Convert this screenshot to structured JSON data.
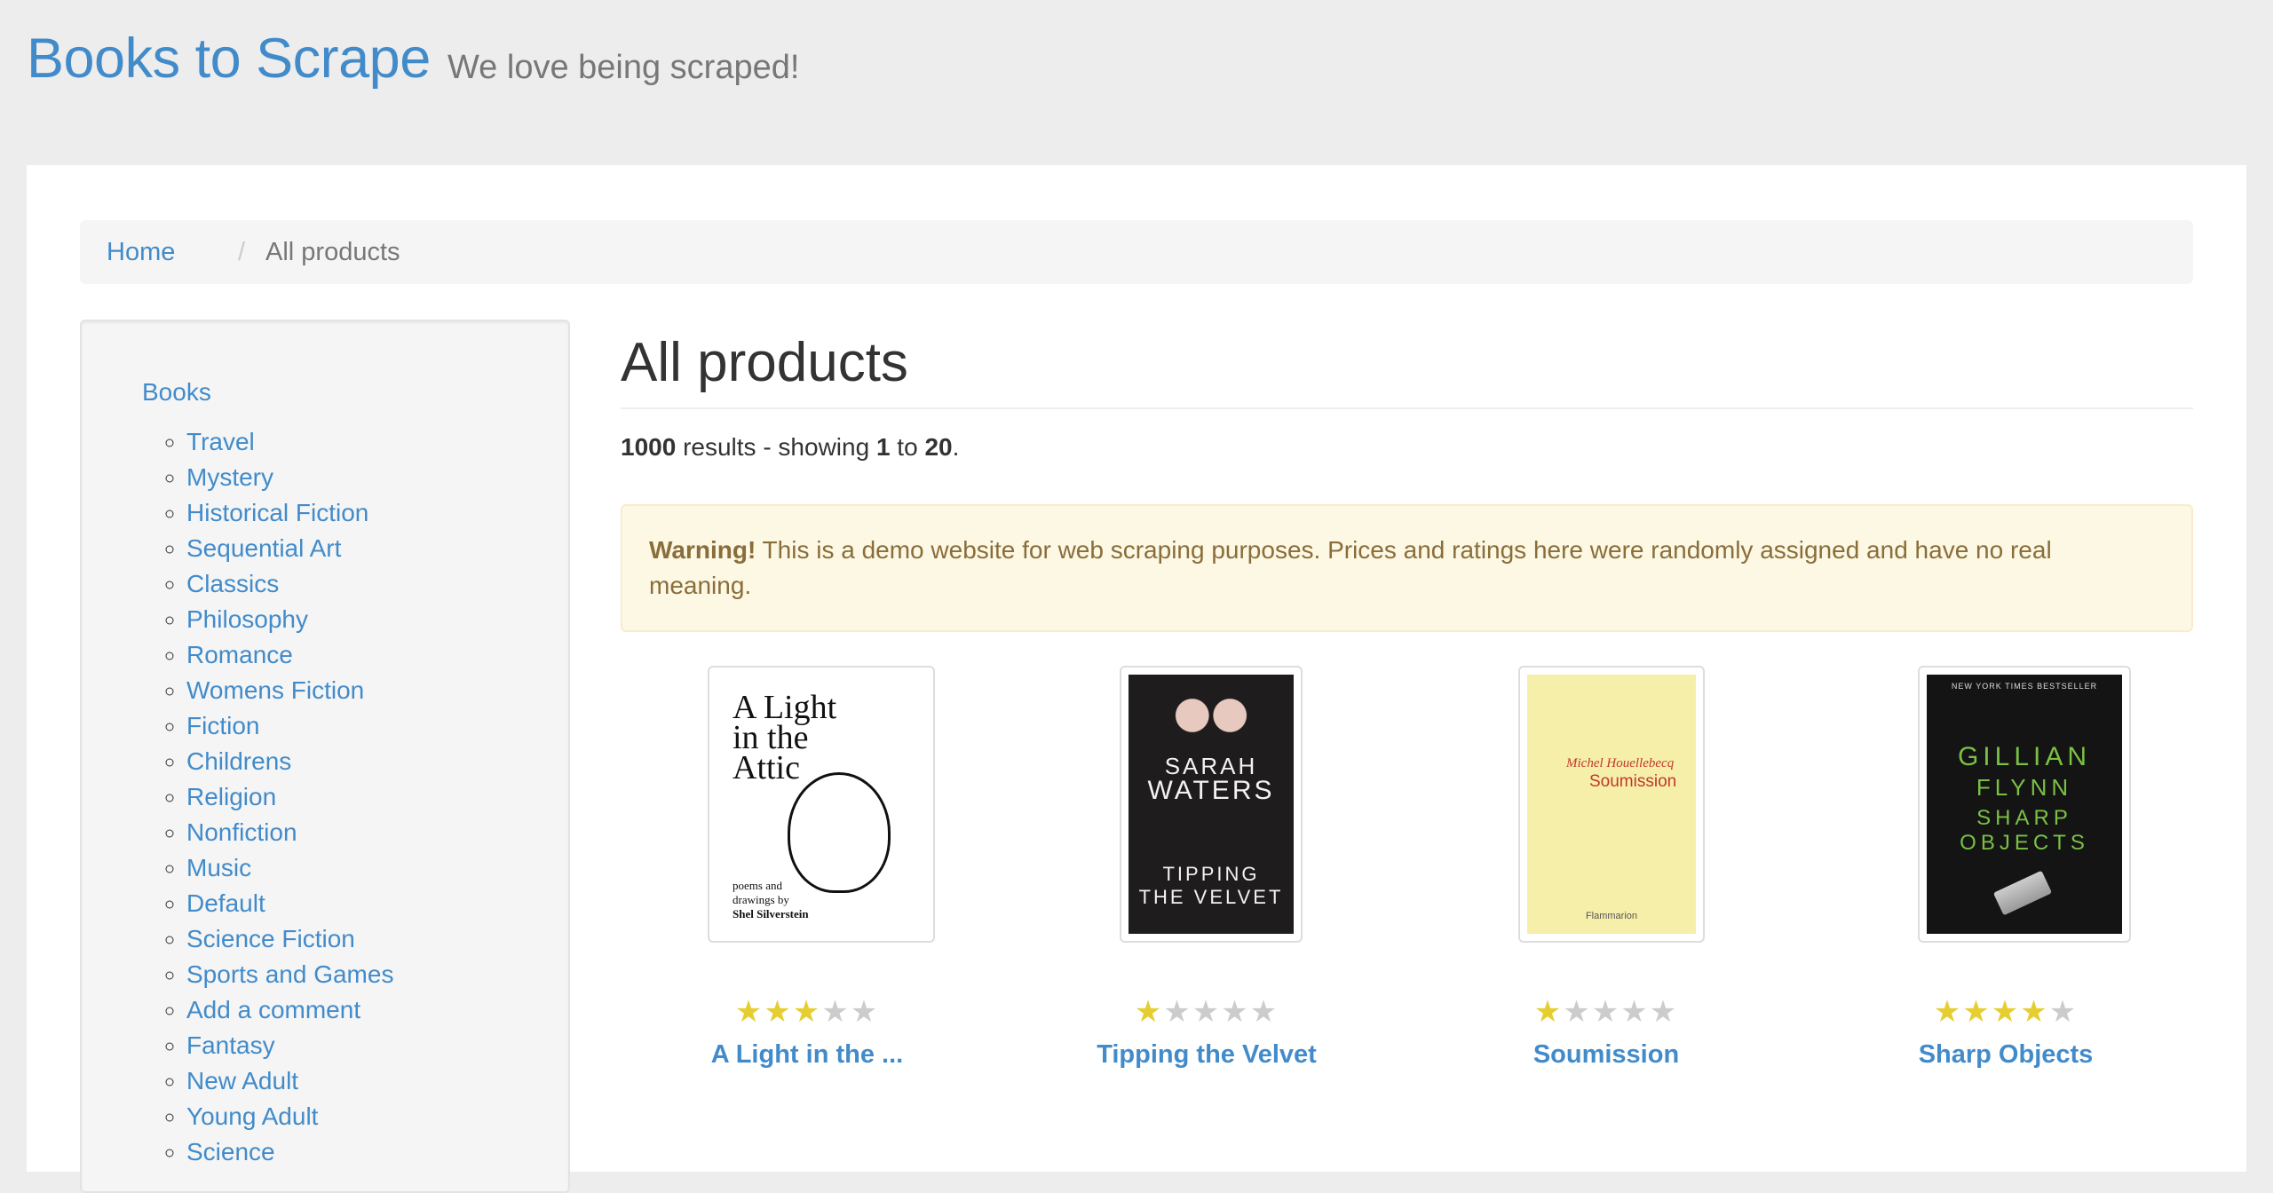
{
  "header": {
    "brand": "Books to Scrape",
    "tagline": "We love being scraped!"
  },
  "breadcrumb": {
    "home": "Home",
    "separator": "/",
    "active": "All products"
  },
  "sidebar": {
    "books_label": "Books",
    "categories": [
      "Travel",
      "Mystery",
      "Historical Fiction",
      "Sequential Art",
      "Classics",
      "Philosophy",
      "Romance",
      "Womens Fiction",
      "Fiction",
      "Childrens",
      "Religion",
      "Nonfiction",
      "Music",
      "Default",
      "Science Fiction",
      "Sports and Games",
      "Add a comment",
      "Fantasy",
      "New Adult",
      "Young Adult",
      "Science"
    ]
  },
  "main": {
    "title": "All products",
    "results": {
      "total": "1000",
      "text1": " results - showing ",
      "from": "1",
      "text2": " to ",
      "to": "20",
      "end": "."
    },
    "warning": {
      "strong": "Warning!",
      "text": " This is a demo website for web scraping purposes. Prices and ratings here were randomly assigned and have no real meaning."
    }
  },
  "products": [
    {
      "title": "A Light in the ...",
      "rating": 3,
      "cover": {
        "bg": "#ffffff",
        "fg": "#111111",
        "lines": [
          "A Light",
          "in the",
          "Attic"
        ],
        "byline": [
          "poems and",
          "drawings by",
          "Shel Silverstein"
        ]
      }
    },
    {
      "title": "Tipping the Velvet",
      "rating": 1,
      "cover": {
        "bg": "#1e1c1c",
        "fg": "#f2f2f2",
        "lines": [
          "SARAH",
          "WATERS",
          "TIPPING",
          "THE VELVET"
        ]
      }
    },
    {
      "title": "Soumission",
      "rating": 1,
      "cover": {
        "bg": "#f6efa9",
        "fg": "#c0392b",
        "lines": [
          "Michel Houellebecq",
          "Soumission",
          "Flammarion"
        ]
      }
    },
    {
      "title": "Sharp Objects",
      "rating": 4,
      "cover": {
        "bg": "#141414",
        "fg": "#7ac143",
        "lines": [
          "NEW YORK TIMES BESTSELLER",
          "GILLIAN",
          "FLYNN",
          "SHARP",
          "OBJECTS"
        ]
      }
    }
  ],
  "colors": {
    "link": "#428bca",
    "star_on": "#e6ce31",
    "star_off": "#cccccc",
    "warning_bg": "#fcf8e3",
    "warning_text": "#8a6d3b"
  }
}
